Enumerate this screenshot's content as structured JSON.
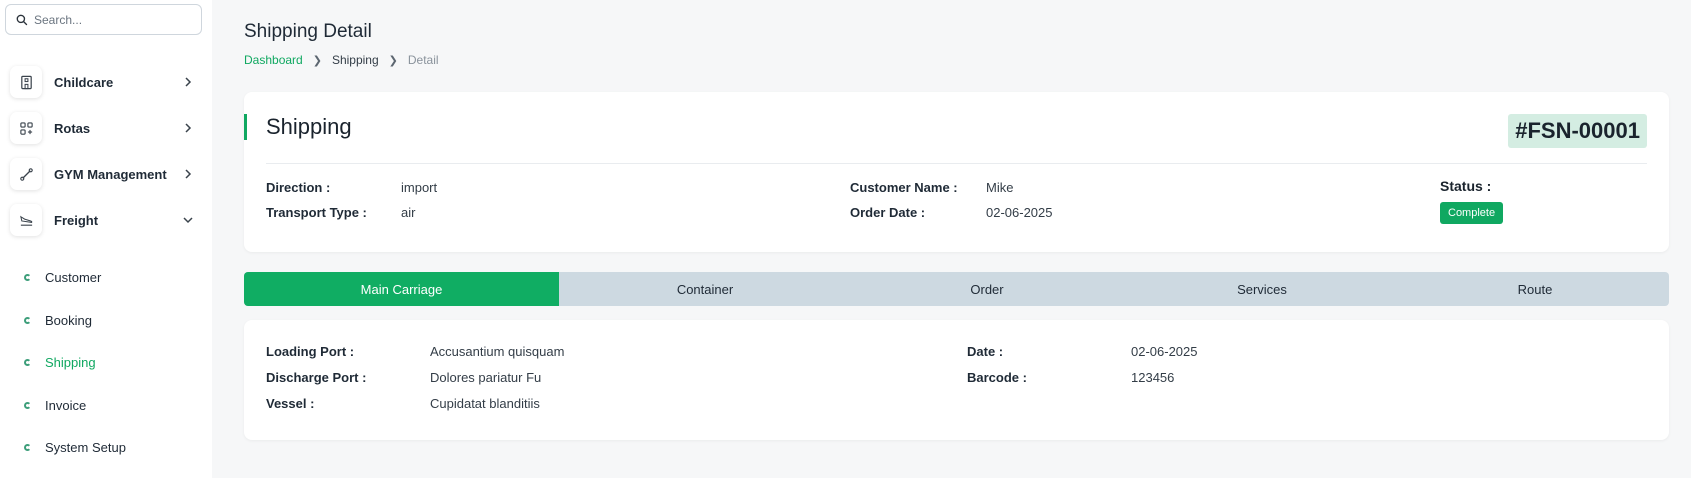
{
  "search": {
    "placeholder": "Search..."
  },
  "sidebar": {
    "items": [
      {
        "label": "Childcare",
        "icon": "building-icon"
      },
      {
        "label": "Rotas",
        "icon": "grid-plus-icon"
      },
      {
        "label": "GYM Management",
        "icon": "dumbbell-icon"
      },
      {
        "label": "Freight",
        "icon": "plane-landing-icon"
      }
    ],
    "sub_items": [
      {
        "label": "Customer"
      },
      {
        "label": "Booking"
      },
      {
        "label": "Shipping"
      },
      {
        "label": "Invoice"
      },
      {
        "label": "System Setup"
      }
    ],
    "active_sub_item": "Shipping"
  },
  "page": {
    "title": "Shipping Detail",
    "breadcrumb": {
      "home": "Dashboard",
      "section": "Shipping",
      "current": "Detail"
    }
  },
  "header_card": {
    "title": "Shipping",
    "shipment_id": "#FSN-00001",
    "direction_label": "Direction :",
    "direction_value": "import",
    "transport_label": "Transport Type :",
    "transport_value": "air",
    "customer_label": "Customer Name :",
    "customer_value": "Mike",
    "order_date_label": "Order Date :",
    "order_date_value": "02-06-2025",
    "status_label": "Status :",
    "status_value": "Complete"
  },
  "tabs": [
    {
      "label": "Main Carriage"
    },
    {
      "label": "Container"
    },
    {
      "label": "Order"
    },
    {
      "label": "Services"
    },
    {
      "label": "Route"
    }
  ],
  "active_tab": "Main Carriage",
  "detail": {
    "loading_port_label": "Loading Port :",
    "loading_port_value": "Accusantium quisquam",
    "discharge_port_label": "Discharge Port :",
    "discharge_port_value": "Dolores pariatur Fu",
    "vessel_label": "Vessel :",
    "vessel_value": "Cupidatat blanditiis",
    "date_label": "Date :",
    "date_value": "02-06-2025",
    "barcode_label": "Barcode :",
    "barcode_value": "123456"
  },
  "colors": {
    "accent": "#10a861",
    "tab_bar": "#cdd9e1",
    "id_badge": "#d4ede2"
  }
}
